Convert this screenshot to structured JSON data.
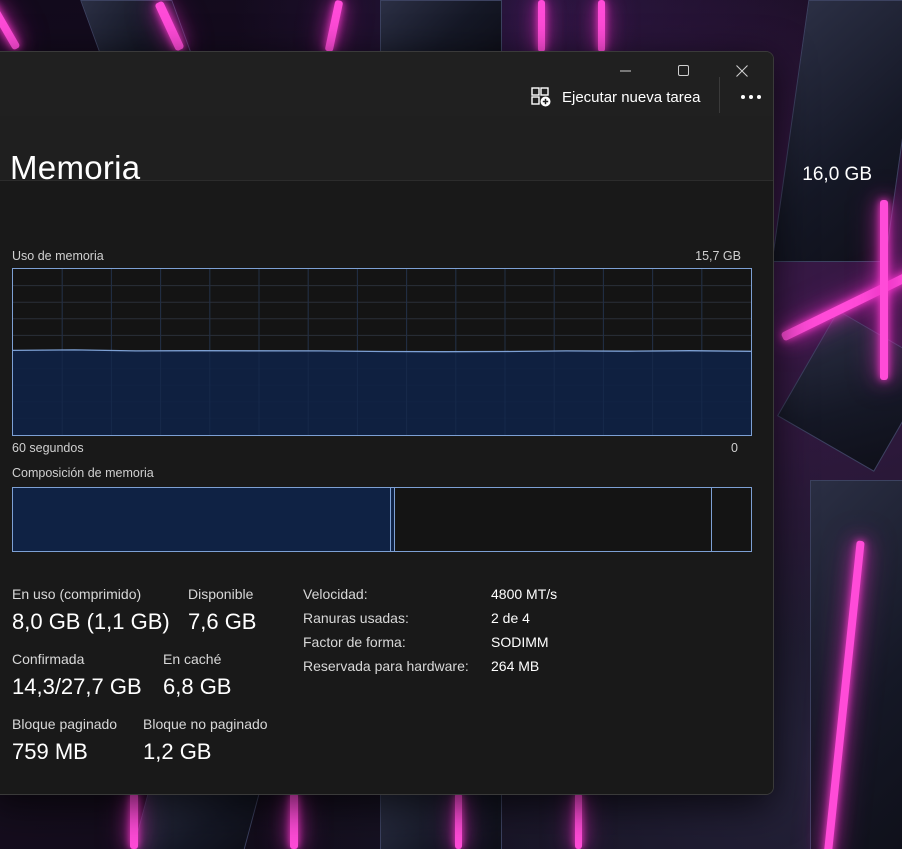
{
  "toolbar": {
    "run_new_task_label": "Ejecutar nueva tarea",
    "more_label": "•••"
  },
  "memory": {
    "title": "Memoria",
    "total": "16,0 GB",
    "usage_label": "Uso de memoria",
    "usage_max": "15,7 GB",
    "time_left_label": "60 segundos",
    "time_right_label": "0",
    "composition_label": "Composición de memoria"
  },
  "chart_data": {
    "type": "area",
    "title": "Uso de memoria",
    "xlabel": "",
    "ylabel": "",
    "x": [
      60,
      55,
      50,
      45,
      40,
      35,
      30,
      25,
      20,
      15,
      10,
      5,
      0
    ],
    "values": [
      8.0,
      8.05,
      7.95,
      7.97,
      7.96,
      7.95,
      7.9,
      7.88,
      7.9,
      7.95,
      7.93,
      7.97,
      7.92
    ],
    "xlim": [
      60,
      0
    ],
    "ylim": [
      0,
      15.7
    ],
    "grid": true
  },
  "composition": {
    "in_use_fraction": 0.511,
    "modified_fraction": 0.006,
    "standby_fraction": 0.43,
    "free_fraction": 0.053
  },
  "stats": {
    "in_use_label": "En uso (comprimido)",
    "in_use_value": "8,0 GB (1,1 GB)",
    "available_label": "Disponible",
    "available_value": "7,6 GB",
    "committed_label": "Confirmada",
    "committed_value": "14,3/27,7 GB",
    "cached_label": "En caché",
    "cached_value": "6,8 GB",
    "paged_pool_label": "Bloque paginado",
    "paged_pool_value": "759 MB",
    "nonpaged_pool_label": "Bloque no paginado",
    "nonpaged_pool_value": "1,2 GB"
  },
  "details": {
    "speed_label": "Velocidad:",
    "speed_value": "4800 MT/s",
    "slots_label": "Ranuras usadas:",
    "slots_value": "2 de 4",
    "form_label": "Factor de forma:",
    "form_value": "SODIMM",
    "reserved_label": "Reservada para hardware:",
    "reserved_value": "264 MB"
  },
  "colors": {
    "accent": "#7da0d4",
    "graph_fill": "#0f2244",
    "background": "#191919"
  }
}
